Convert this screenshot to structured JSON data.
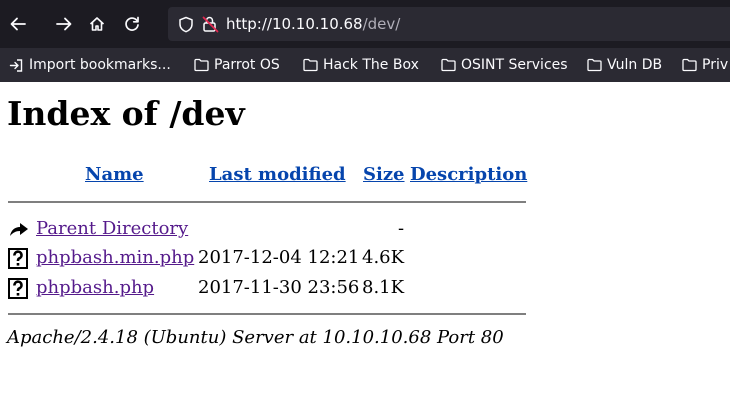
{
  "browser": {
    "url_host": "http://10.10.10.68",
    "url_path": "/dev/",
    "bookmarks": [
      {
        "label": "Import bookmarks...",
        "icon": "import-icon"
      },
      {
        "label": "Parrot OS",
        "icon": "folder-icon"
      },
      {
        "label": "Hack The Box",
        "icon": "folder-icon"
      },
      {
        "label": "OSINT Services",
        "icon": "folder-icon"
      },
      {
        "label": "Vuln DB",
        "icon": "folder-icon"
      },
      {
        "label": "Priv",
        "icon": "folder-icon"
      }
    ]
  },
  "page": {
    "title": "Index of /dev",
    "columns": {
      "name": "Name",
      "last_modified": "Last modified",
      "size": "Size",
      "description": "Description"
    },
    "parent": {
      "label": "Parent Directory",
      "size": "-"
    },
    "files": [
      {
        "name": "phpbash.min.php",
        "modified": "2017-12-04 12:21",
        "size": "4.6K"
      },
      {
        "name": "phpbash.php",
        "modified": "2017-11-30 23:56",
        "size": "8.1K"
      }
    ],
    "footer": "Apache/2.4.18 (Ubuntu) Server at 10.10.10.68 Port 80"
  }
}
